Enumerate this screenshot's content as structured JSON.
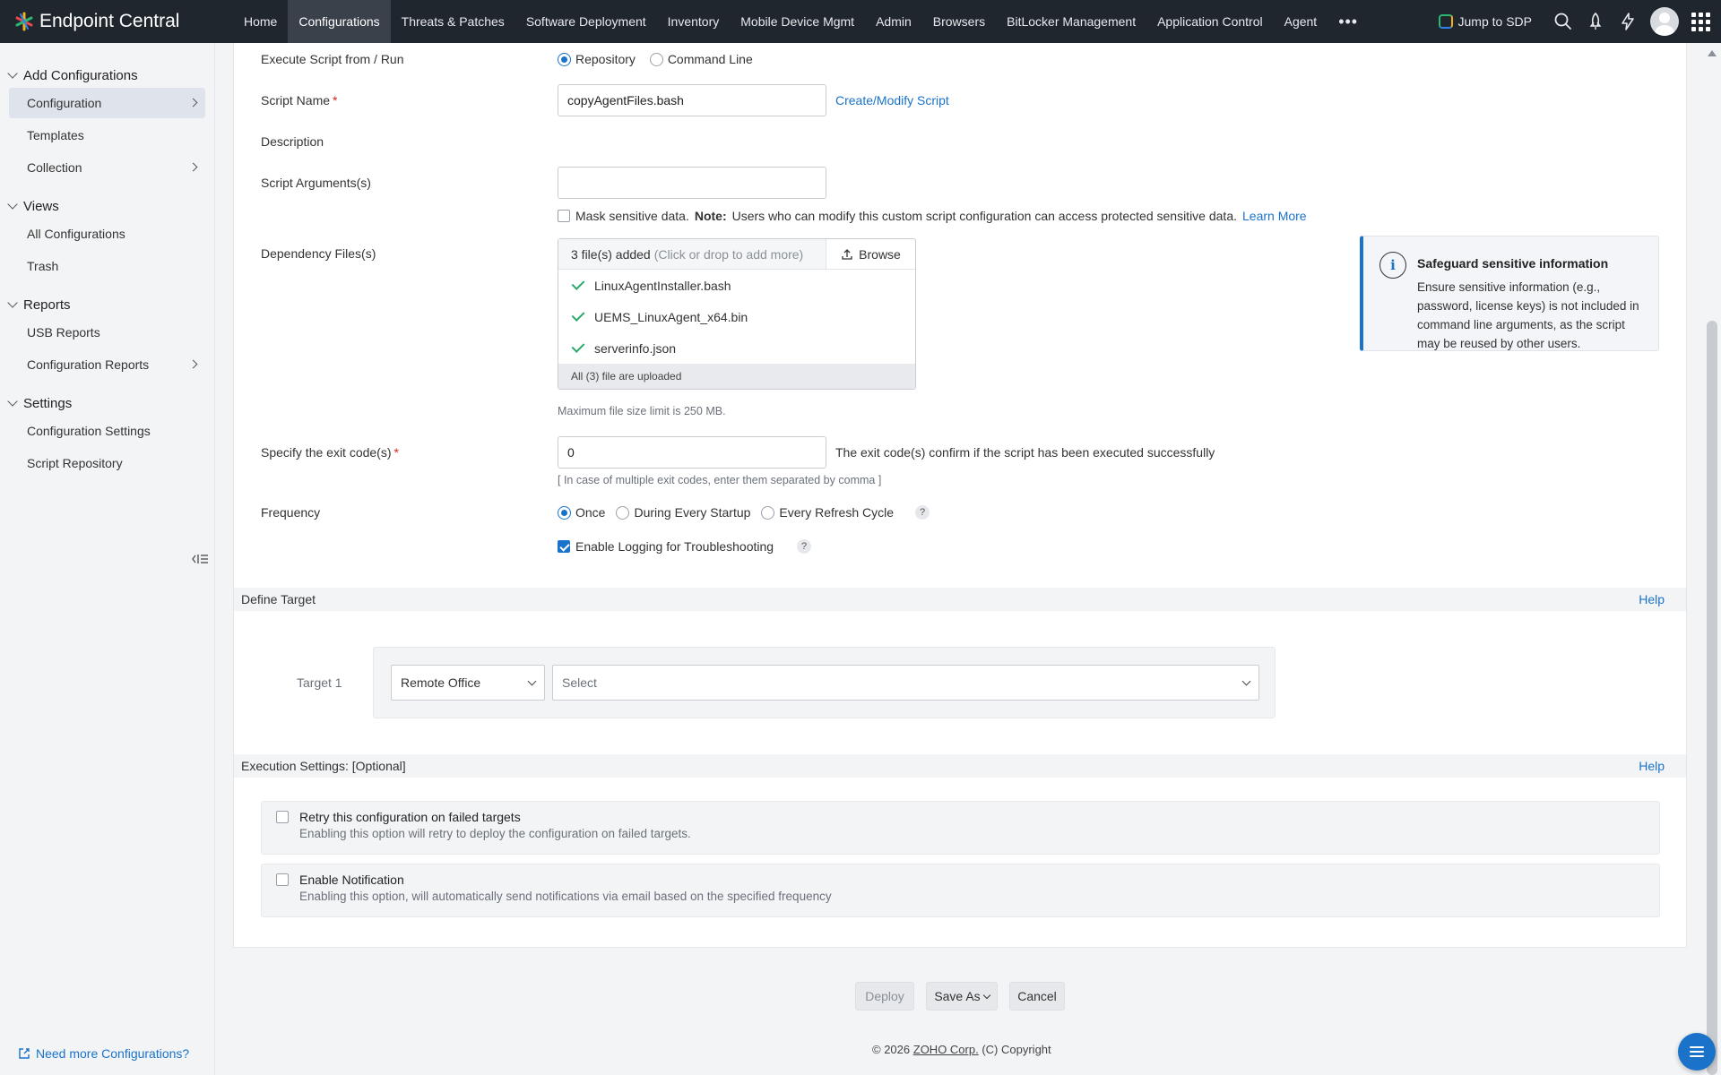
{
  "topbar": {
    "brand": "Endpoint Central",
    "nav": [
      "Home",
      "Configurations",
      "Threats & Patches",
      "Software Deployment",
      "Inventory",
      "Mobile Device Mgmt",
      "Admin",
      "Browsers",
      "BitLocker Management",
      "Application Control",
      "Agent"
    ],
    "active_nav": "Configurations",
    "more": "•••",
    "jump_to_sdp": "Jump to SDP"
  },
  "sidebar": {
    "sections": [
      {
        "title": "Add Configurations",
        "items": [
          {
            "label": "Configuration"
          },
          {
            "label": "Templates"
          },
          {
            "label": "Collection"
          }
        ]
      },
      {
        "title": "Views",
        "items": [
          {
            "label": "All Configurations"
          },
          {
            "label": "Trash"
          }
        ]
      },
      {
        "title": "Reports",
        "items": [
          {
            "label": "USB Reports"
          },
          {
            "label": "Configuration Reports"
          }
        ]
      },
      {
        "title": "Settings",
        "items": [
          {
            "label": "Configuration Settings"
          },
          {
            "label": "Script Repository"
          }
        ]
      }
    ],
    "need_more": "Need more Configurations?"
  },
  "form": {
    "execute_label": "Execute Script from / Run",
    "execute_options": [
      "Repository",
      "Command Line"
    ],
    "script_name_label": "Script Name",
    "script_name_value": "copyAgentFiles.bash",
    "create_modify_link": "Create/Modify Script",
    "description_label": "Description",
    "script_args_label": "Script Arguments(s)",
    "script_args_value": "",
    "mask_text": "Mask sensitive data.",
    "mask_note_bold": "Note:",
    "mask_note": "Users who can modify this custom script configuration can access protected sensitive data.",
    "learn_more": "Learn More",
    "dependency_label": "Dependency Files(s)",
    "dep_count": "3 file(s) added",
    "dep_hint": "(Click or drop to add more)",
    "browse": "Browse",
    "files": [
      "LinuxAgentInstaller.bash",
      "UEMS_LinuxAgent_x64.bin",
      "serverinfo.json"
    ],
    "dep_footer": "All (3) file are uploaded",
    "max_size": "Maximum file size limit is 250 MB.",
    "exit_code_label": "Specify the exit code(s)",
    "exit_code_value": "0",
    "exit_code_info": "The exit code(s) confirm if the script has been executed successfully",
    "exit_code_hint": "[ In case of multiple exit codes, enter them separated by comma ]",
    "frequency_label": "Frequency",
    "frequency_options": [
      "Once",
      "During Every Startup",
      "Every Refresh Cycle"
    ],
    "enable_logging": "Enable Logging for Troubleshooting",
    "help_q": "?"
  },
  "info_card": {
    "icon": "i",
    "title": "Safeguard sensitive information",
    "body": "Ensure sensitive information (e.g., password, license keys) is not included in command line arguments, as the script may be reused by other users."
  },
  "target": {
    "band_title": "Define Target",
    "help": "Help",
    "target_label": "Target 1",
    "type_value": "Remote Office",
    "select_placeholder": "Select"
  },
  "execution": {
    "band_title": "Execution Settings: [Optional]",
    "help": "Help",
    "retry_title": "Retry this configuration on failed targets",
    "retry_desc": "Enabling this option will retry to deploy the configuration on failed targets.",
    "notify_title": "Enable Notification",
    "notify_desc": "Enabling this option, will automatically send notifications via email based on the specified frequency"
  },
  "actions": {
    "deploy": "Deploy",
    "save_as": "Save As",
    "cancel": "Cancel"
  },
  "footer": {
    "prefix": "© 2026",
    "company": "ZOHO Corp.",
    "suffix": "(C) Copyright"
  },
  "colors": {
    "accent": "#1a73c9",
    "topbar": "#20262e",
    "success": "#2aa86a"
  }
}
